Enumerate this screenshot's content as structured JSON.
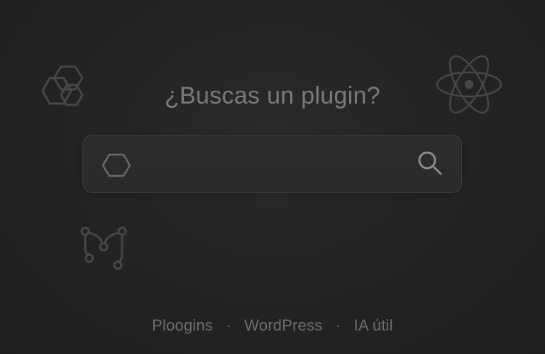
{
  "page": {
    "title": "¿Buscas un plugin?"
  },
  "search": {
    "value": "",
    "placeholder": "",
    "leading_icon": "hexagon-icon",
    "button_icon": "search-icon"
  },
  "decorations": [
    {
      "icon": "hexagons-icon"
    },
    {
      "icon": "atom-icon"
    },
    {
      "icon": "git-branch-icon"
    }
  ],
  "footer": {
    "items": [
      "Ploogins",
      "WordPress",
      "IA útil"
    ],
    "separator": "·"
  },
  "colors": {
    "background": "#232323",
    "text": "#7a7a7a",
    "footer_text": "#6e6e6e",
    "icon_stroke": "#4a4a4a",
    "search_border": "#3d3d3d"
  }
}
